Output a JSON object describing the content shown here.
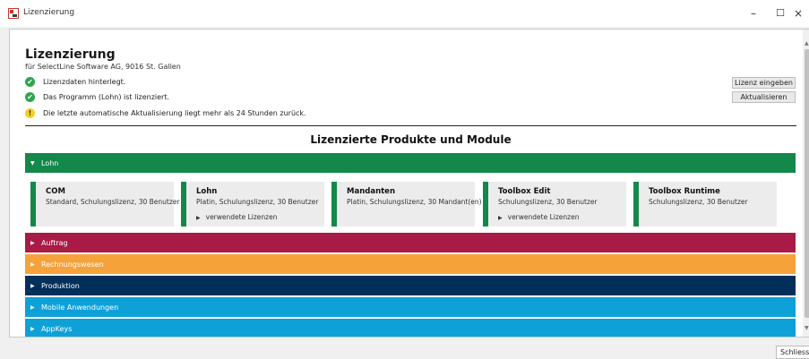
{
  "window": {
    "title": "Lizenzierung",
    "minimize_glyph": "–",
    "maximize_glyph": "☐",
    "close_glyph": "×"
  },
  "header": {
    "title": "Lizenzierung",
    "subtitle": "für SelectLine Software AG, 9016 St. Gallen"
  },
  "status": [
    {
      "icon": "check-circle-icon",
      "text": "Lizenzdaten hinterlegt."
    },
    {
      "icon": "check-circle-icon",
      "text": "Das Programm (Lohn) ist lizenziert."
    },
    {
      "icon": "warning-circle-icon",
      "text": "Die letzte automatische Aktualisierung liegt mehr als 24 Stunden zurück."
    }
  ],
  "actions": {
    "enter_license": "Lizenz eingeben",
    "refresh": "Aktualisieren"
  },
  "section_title": "Lizenzierte Produkte und Module",
  "groups": [
    {
      "label": "Lohn",
      "expanded": true,
      "color": "#13884a"
    },
    {
      "label": "Auftrag",
      "expanded": false,
      "color": "#a81b46"
    },
    {
      "label": "Rechnungswesen",
      "expanded": false,
      "color": "#f6a23a"
    },
    {
      "label": "Produktion",
      "expanded": false,
      "color": "#002f5a"
    },
    {
      "label": "Mobile Anwendungen",
      "expanded": false,
      "color": "#0ea1d8"
    },
    {
      "label": "AppKeys",
      "expanded": false,
      "color": "#0ea1d8"
    }
  ],
  "cards": [
    {
      "title": "COM",
      "desc": "Standard, Schulungslizenz, 30 Benutzer",
      "link": ""
    },
    {
      "title": "Lohn",
      "desc": "Platin, Schulungslizenz, 30 Benutzer",
      "link": "verwendete Lizenzen"
    },
    {
      "title": "Mandanten",
      "desc": "Platin, Schulungslizenz, 30 Mandant(en)",
      "link": ""
    },
    {
      "title": "Toolbox Edit",
      "desc": "Schulungslizenz, 30 Benutzer",
      "link": "verwendete Lizenzen"
    },
    {
      "title": "Toolbox Runtime",
      "desc": "Schulungslizenz, 30 Benutzer",
      "link": ""
    }
  ],
  "footer": {
    "close_label": "Schliessen"
  },
  "icons": {
    "check": "✔",
    "warning": "!",
    "expanded": "▼",
    "collapsed": "▶",
    "scroll_up": "▲",
    "scroll_down": "▼"
  }
}
